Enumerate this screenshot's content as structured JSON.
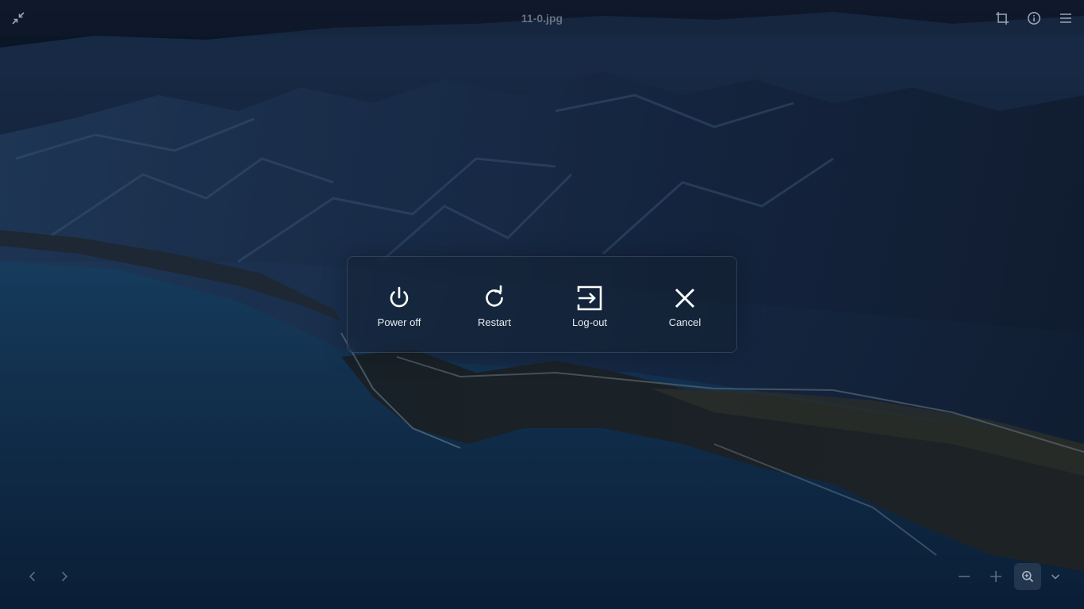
{
  "window": {
    "title": "11-0.jpg"
  },
  "header": {
    "left_button_icon": "leave-fullscreen-icon",
    "right_buttons": [
      {
        "icon": "crop-icon"
      },
      {
        "icon": "info-icon"
      },
      {
        "icon": "hamburger-menu-icon"
      }
    ]
  },
  "session_dialog": {
    "actions": [
      {
        "label": "Power off",
        "icon": "power-icon"
      },
      {
        "label": "Restart",
        "icon": "restart-icon"
      },
      {
        "label": "Log-out",
        "icon": "logout-icon"
      },
      {
        "label": "Cancel",
        "icon": "close-icon"
      }
    ]
  },
  "footer": {
    "nav": [
      {
        "icon": "chevron-left-icon"
      },
      {
        "icon": "chevron-right-icon"
      }
    ],
    "zoom": [
      {
        "icon": "minus-icon"
      },
      {
        "icon": "plus-icon"
      },
      {
        "icon": "zoom-fit-icon"
      },
      {
        "icon": "chevron-down-icon"
      }
    ]
  },
  "colors": {
    "dialog_text": "#e8edf3",
    "header_icon": "#9aa6b6",
    "sea": "#1d4468",
    "mountains": "#1b2c45"
  }
}
